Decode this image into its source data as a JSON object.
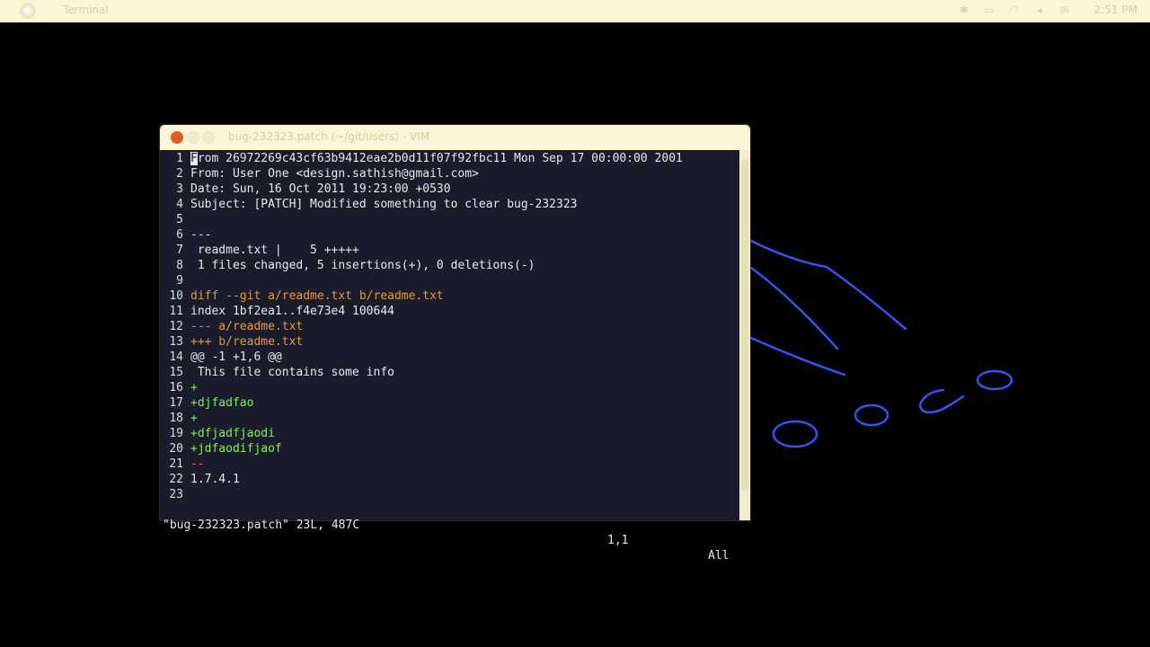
{
  "panel": {
    "title": "Terminal",
    "clock": "2:51 PM"
  },
  "window": {
    "title": "bug-232323.patch (~/git/users) - VIM"
  },
  "editor": {
    "lines": [
      {
        "num": "1",
        "text": "From 26972269c43cf63b9412eae2b0d11f07f92fbc11 Mon Sep 17 00:00:00 2001",
        "style": "white"
      },
      {
        "num": "2",
        "text": "From: User One <design.sathish@gmail.com>",
        "style": "white"
      },
      {
        "num": "3",
        "text": "Date: Sun, 16 Oct 2011 19:23:00 +0530",
        "style": "white"
      },
      {
        "num": "4",
        "text": "Subject: [PATCH] Modified something to clear bug-232323",
        "style": "white"
      },
      {
        "num": "5",
        "text": "",
        "style": "white"
      },
      {
        "num": "6",
        "text": "---",
        "style": "white"
      },
      {
        "num": "7",
        "text": " readme.txt |    5 +++++",
        "style": "white"
      },
      {
        "num": "8",
        "text": " 1 files changed, 5 insertions(+), 0 deletions(-)",
        "style": "white"
      },
      {
        "num": "9",
        "text": "",
        "style": "white"
      },
      {
        "num": "10",
        "text": "diff --git a/readme.txt b/readme.txt",
        "style": "diff"
      },
      {
        "num": "11",
        "text": "index 1bf2ea1..f4e73e4 100644",
        "style": "white"
      },
      {
        "num": "12",
        "text": "--- a/readme.txt",
        "style": "diff"
      },
      {
        "num": "13",
        "text": "+++ b/readme.txt",
        "style": "diff"
      },
      {
        "num": "14",
        "text": "@@ -1 +1,6 @@",
        "style": "white"
      },
      {
        "num": "15",
        "text": " This file contains some info",
        "style": "white"
      },
      {
        "num": "16",
        "text": "+",
        "style": "add"
      },
      {
        "num": "17",
        "text": "+djfadfao",
        "style": "add"
      },
      {
        "num": "18",
        "text": "+",
        "style": "add"
      },
      {
        "num": "19",
        "text": "+dfjadfjaodi",
        "style": "add"
      },
      {
        "num": "20",
        "text": "+jdfaodifjaof",
        "style": "add"
      },
      {
        "num": "21",
        "text": "--",
        "style": "del"
      },
      {
        "num": "22",
        "text": "1.7.4.1",
        "style": "white"
      },
      {
        "num": "23",
        "text": "",
        "style": "white"
      }
    ]
  },
  "status": {
    "file_info": "\"bug-232323.patch\" 23L, 487C",
    "position": "1,1",
    "scroll": "All"
  },
  "colors": {
    "editor_bg": "#1b1c2b",
    "diff_header": "#e39a3c",
    "added": "#7ff24f",
    "removed": "#ff6464",
    "annotation_ink": "#2f56f0"
  }
}
